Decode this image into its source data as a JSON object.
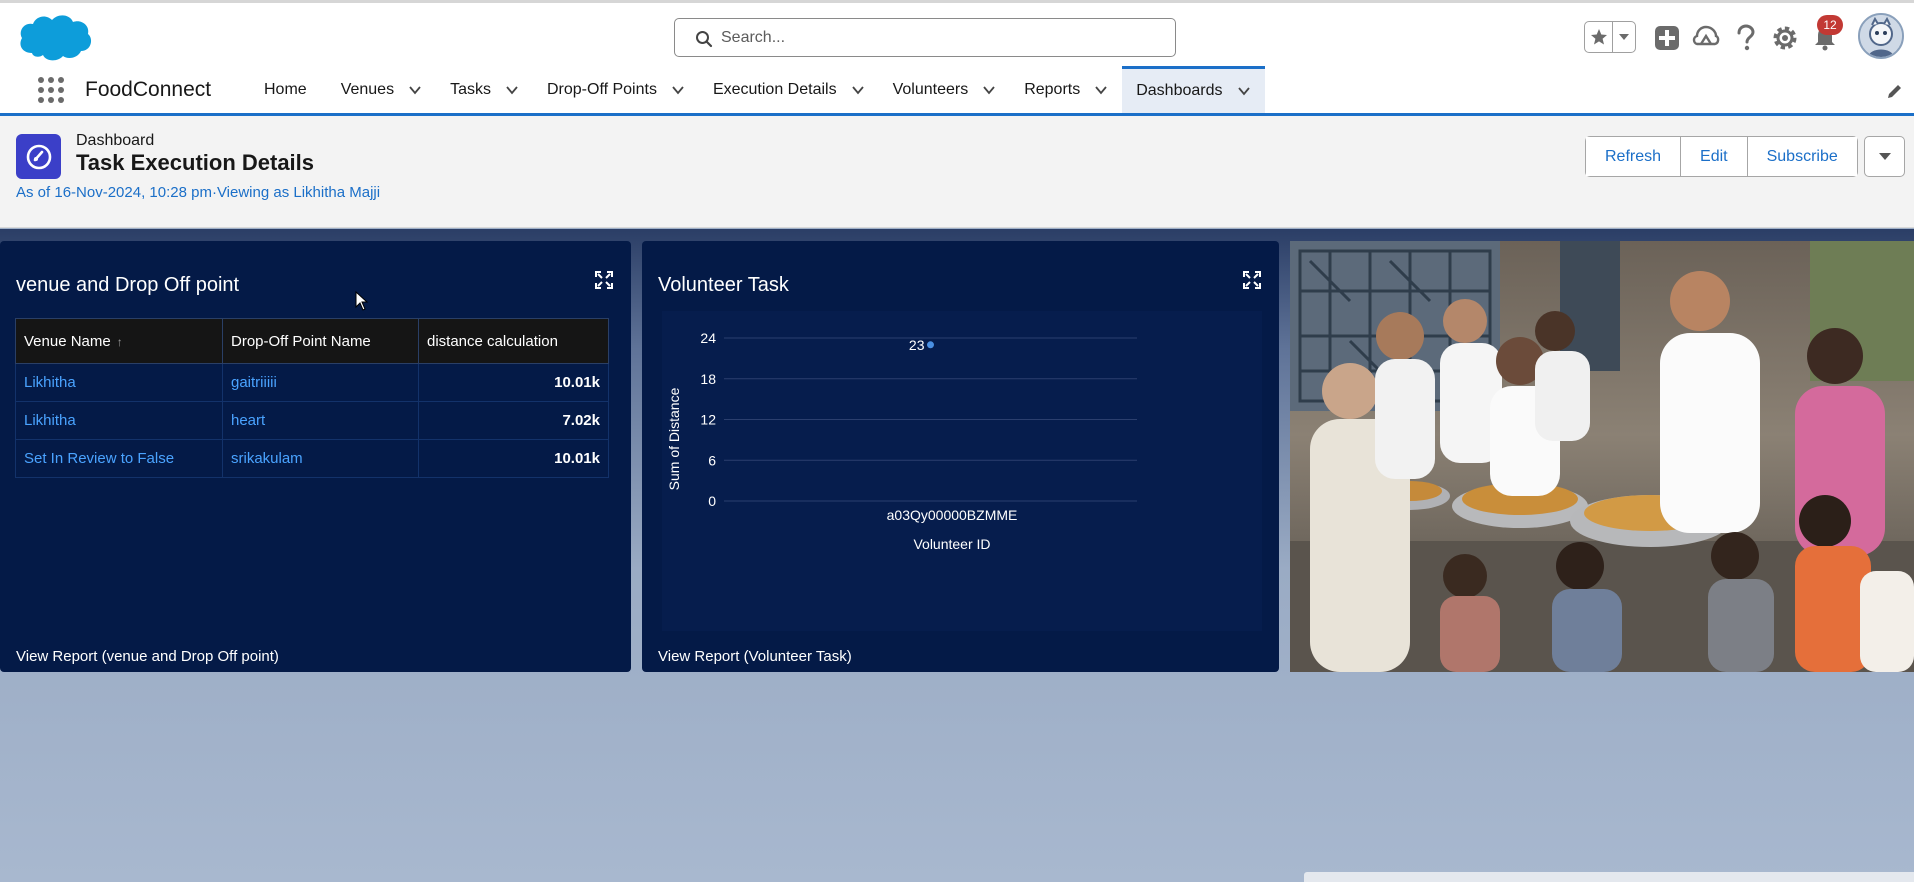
{
  "header": {
    "search_placeholder": "Search...",
    "notification_count": "12"
  },
  "nav": {
    "app_name": "FoodConnect",
    "items": [
      {
        "label": "Home"
      },
      {
        "label": "Venues"
      },
      {
        "label": "Tasks"
      },
      {
        "label": "Drop-Off Points"
      },
      {
        "label": "Execution Details"
      },
      {
        "label": "Volunteers"
      },
      {
        "label": "Reports"
      },
      {
        "label": "Dashboards"
      }
    ]
  },
  "dashboard": {
    "type_label": "Dashboard",
    "title": "Task Execution Details",
    "meta": "As of 16-Nov-2024, 10:28 pm·Viewing as Likhitha Majji",
    "buttons": {
      "refresh": "Refresh",
      "edit": "Edit",
      "subscribe": "Subscribe"
    }
  },
  "panel_table": {
    "title": "venue and Drop Off point",
    "columns": [
      "Venue Name",
      "Drop-Off Point Name",
      "distance calculation"
    ],
    "rows": [
      [
        "Likhitha",
        "gaitriiiii",
        "10.01k"
      ],
      [
        "Likhitha",
        "heart",
        "7.02k"
      ],
      [
        "Set In Review to False",
        "srikakulam",
        "10.01k"
      ]
    ],
    "view_report": "View Report (venue and Drop Off point)"
  },
  "panel_chart": {
    "title": "Volunteer Task",
    "view_report": "View Report (Volunteer Task)"
  },
  "chart_data": {
    "type": "scatter",
    "title": "Volunteer Task",
    "xlabel": "Volunteer ID",
    "ylabel": "Sum of Distance",
    "categories": [
      "a03Qy00000BZMME"
    ],
    "values": [
      23
    ],
    "data_labels": [
      "23"
    ],
    "ylim": [
      0,
      24
    ],
    "yticks": [
      "0",
      "6",
      "12",
      "18",
      "24"
    ],
    "grid": true,
    "colors": {
      "point": "#4a90e2"
    }
  },
  "colors": {
    "brand_blue": "#1b6fc8",
    "panel_bg": "#041a47",
    "link": "#4aa3ff",
    "badge": "#c23934"
  }
}
